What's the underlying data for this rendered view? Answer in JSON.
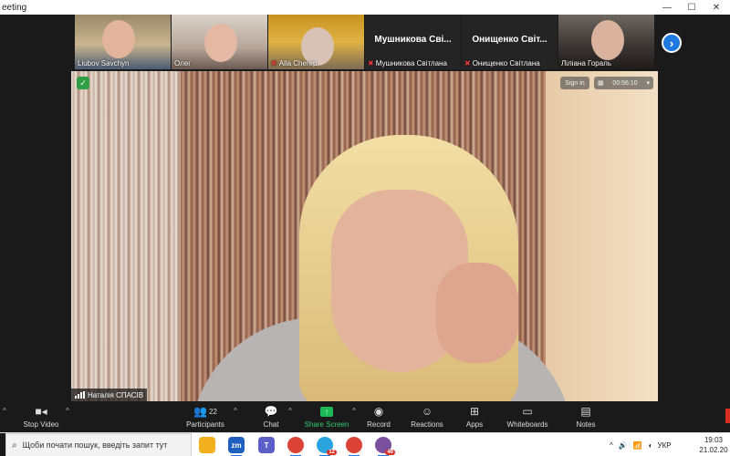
{
  "window": {
    "title": "eeting"
  },
  "thumbnails": [
    {
      "name": "Liubov Savchyn",
      "muted": false,
      "video": true
    },
    {
      "name": "Олег",
      "muted": false,
      "video": true
    },
    {
      "name": "Alla Cherep",
      "muted": true,
      "video": true
    },
    {
      "name": "Мушникова Світлана",
      "big_name": "Мушникова Сві...",
      "muted": true,
      "video": false
    },
    {
      "name": "Онищенко Світлана",
      "big_name": "Онищенко Світ...",
      "muted": true,
      "video": false
    },
    {
      "name": "Ліліана Гораль",
      "muted": false,
      "video": true
    }
  ],
  "main_video": {
    "speaker_name": "Наталія СПАСІВ",
    "sign_in_label": "Sign in",
    "timer": "00:56:10"
  },
  "toolbar": {
    "stop_video": "Stop Video",
    "participants": "Participants",
    "participants_count": "22",
    "chat": "Chat",
    "share_screen": "Share Screen",
    "record": "Record",
    "reactions": "Reactions",
    "apps": "Apps",
    "whiteboards": "Whiteboards",
    "notes": "Notes"
  },
  "taskbar": {
    "search_placeholder": "Щоби почати пошук, введіть запит тут",
    "apps": [
      {
        "name": "file-explorer",
        "label": "",
        "color": "#f2b01e"
      },
      {
        "name": "zoom",
        "label": "zm",
        "color": "#1f5fbf"
      },
      {
        "name": "teams",
        "label": "T",
        "color": "#5b5fc7"
      },
      {
        "name": "chrome",
        "label": "",
        "color": "#db4437"
      },
      {
        "name": "telegram",
        "label": "",
        "color": "#2aa3df",
        "badge": "12"
      },
      {
        "name": "chrome-2",
        "label": "",
        "color": "#db4437"
      },
      {
        "name": "viber",
        "label": "",
        "color": "#7b519d",
        "badge": "46"
      }
    ],
    "language": "УКР",
    "time": "19:03",
    "date": "21.02.20"
  },
  "colors": {
    "accent": "#1f7ae0",
    "share": "#1db954",
    "muted": "#e03b3b"
  }
}
